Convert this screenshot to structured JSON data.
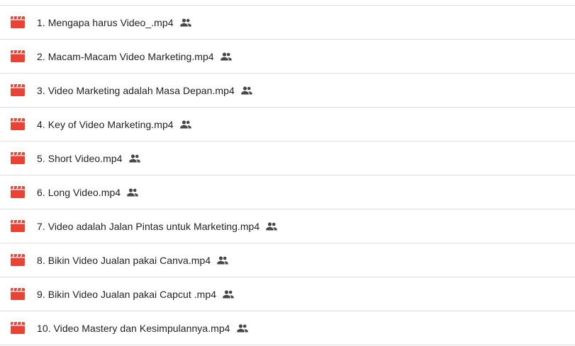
{
  "colors": {
    "video_icon": "#ea4335",
    "shared_icon": "#444746",
    "divider": "#dadce0",
    "text": "#1f1f1f"
  },
  "files": [
    {
      "name": "1. Mengapa harus Video_.mp4",
      "icon": "video-file-icon",
      "shared": true
    },
    {
      "name": "2. Macam-Macam Video Marketing.mp4",
      "icon": "video-file-icon",
      "shared": true
    },
    {
      "name": "3. Video Marketing adalah Masa Depan.mp4",
      "icon": "video-file-icon",
      "shared": true
    },
    {
      "name": "4. Key of Video Marketing.mp4",
      "icon": "video-file-icon",
      "shared": true
    },
    {
      "name": "5. Short Video.mp4",
      "icon": "video-file-icon",
      "shared": true
    },
    {
      "name": "6. Long Video.mp4",
      "icon": "video-file-icon",
      "shared": true
    },
    {
      "name": "7. Video adalah Jalan Pintas untuk Marketing.mp4",
      "icon": "video-file-icon",
      "shared": true
    },
    {
      "name": "8. Bikin Video Jualan pakai Canva.mp4",
      "icon": "video-file-icon",
      "shared": true
    },
    {
      "name": "9. Bikin Video Jualan pakai Capcut .mp4",
      "icon": "video-file-icon",
      "shared": true
    },
    {
      "name": "10. Video Mastery dan Kesimpulannya.mp4",
      "icon": "video-file-icon",
      "shared": true
    }
  ]
}
